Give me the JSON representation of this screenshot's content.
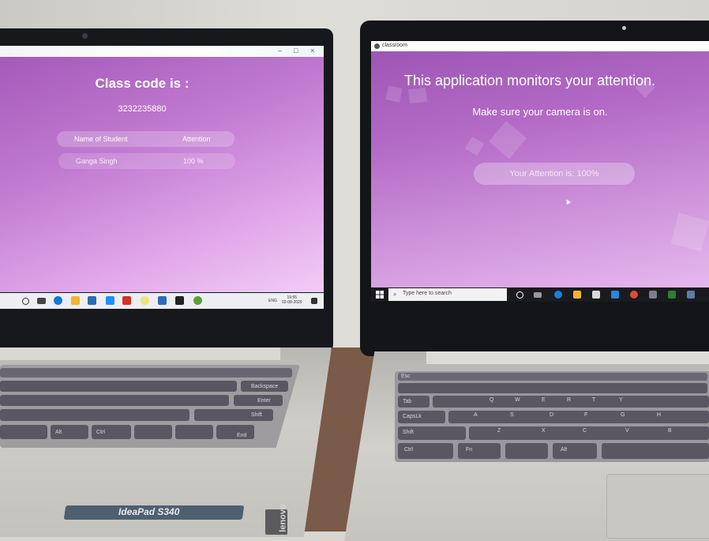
{
  "left_laptop": {
    "window": {
      "minimize_glyph": "–",
      "maximize_glyph": "□",
      "close_glyph": "×"
    },
    "class_code_title": "Class code is :",
    "class_code_value": "3232235880",
    "table": {
      "headers": [
        "Name of Student",
        "Attention"
      ],
      "rows": [
        {
          "name": "Ganga Singh",
          "attention": "100 %"
        }
      ]
    },
    "taskbar": {
      "time": "19:55",
      "date": "02-08-2020",
      "language": "ENG"
    },
    "model_label": "IdeaPad S340",
    "brand_label": "lenovo",
    "keys": {
      "enter": "Enter",
      "shift": "Shift",
      "ctrl": "Ctrl",
      "alt": "Alt",
      "end": "End",
      "backspace": "Backspace"
    }
  },
  "right_laptop": {
    "window_title": "classroom",
    "heading": "This application monitors your attention.",
    "subheading": "Make sure your camera is on.",
    "attention_status": "Your Attention is: 100%",
    "taskbar": {
      "search_placeholder": "Type here to search"
    },
    "keys": {
      "esc": "Esc",
      "tab": "Tab",
      "capslock": "CapsLk",
      "shift": "Shift",
      "ctrl": "Ctrl",
      "fn": "Fn",
      "alt": "Alt",
      "letters": [
        "Q",
        "W",
        "E",
        "R",
        "T",
        "Y",
        "A",
        "S",
        "D",
        "F",
        "G",
        "H",
        "Z",
        "X",
        "C",
        "V",
        "B"
      ]
    }
  },
  "colors": {
    "app_purple": "#a356b8",
    "app_pink": "#f1cdf5",
    "key_dark": "#5a5763",
    "taskbar_dark": "#1a1b1f"
  }
}
